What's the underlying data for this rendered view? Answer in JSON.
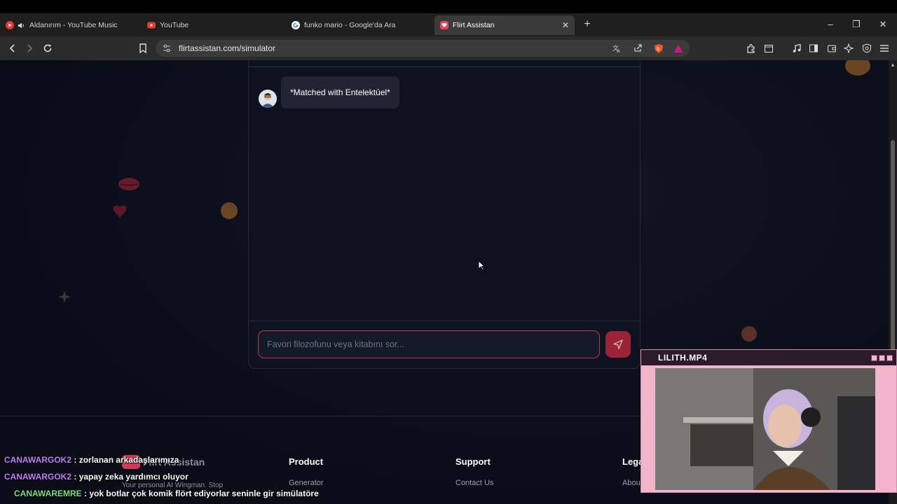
{
  "tabs": [
    {
      "title": "Aldanırım - YouTube Music"
    },
    {
      "title": "YouTube"
    },
    {
      "title": "funko mario - Google'da Ara"
    },
    {
      "title": "Flirt Assistan"
    }
  ],
  "address_bar": {
    "url": "flirtassistan.com/simulator"
  },
  "chat": {
    "matched_message": "*Matched with Entelektüel*",
    "input_placeholder": "Favori filozofunu veya kitabını sor..."
  },
  "footer": {
    "brand_name": "Flirt Assistan",
    "tagline": "Your personal AI Wingman. Stop",
    "columns": [
      {
        "heading": "Product",
        "link": "Generator"
      },
      {
        "heading": "Support",
        "link": "Contact Us"
      },
      {
        "heading": "Lega",
        "link": "Abou"
      }
    ]
  },
  "stream_chat": [
    {
      "user": "CANAWARGOK2",
      "message": ": zorlanan arkadaşlarımıza"
    },
    {
      "user": "CANAWARGOK2",
      "message": ": yapay zeka yardımcı oluyor"
    },
    {
      "user": "CANAWAREMRE",
      "message": ": yok botlar çok komik flört ediyorlar seninle gir simülatöre"
    }
  ],
  "webcam": {
    "title": "LILITH.MP4"
  },
  "colors": {
    "accent": "#c2384f",
    "send_button": "#9a2436",
    "webcam_frame": "#f4b5cc"
  }
}
